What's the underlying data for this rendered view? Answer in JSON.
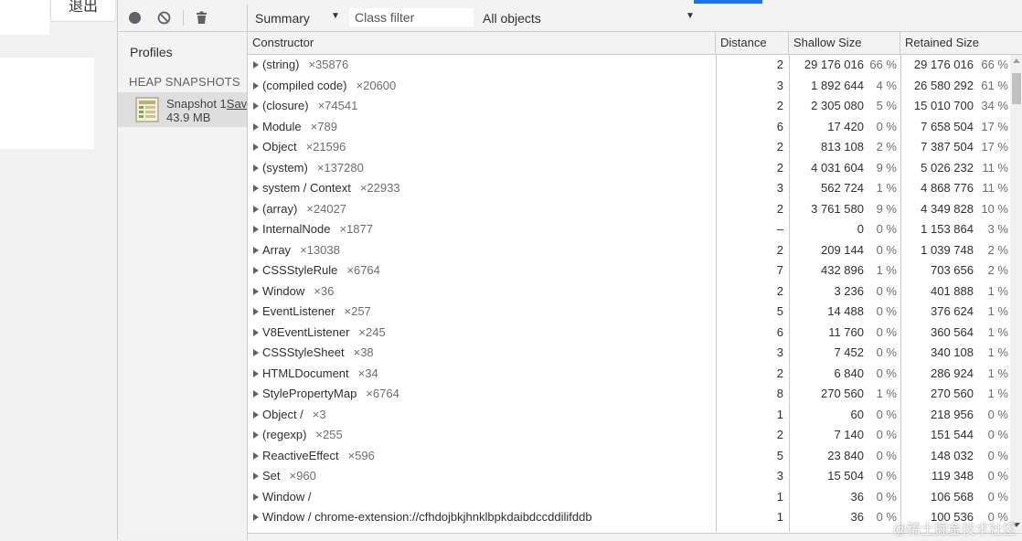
{
  "page": {
    "logout_label": "退出"
  },
  "sidebar": {
    "profiles_label": "Profiles",
    "heap_snapshots_label": "HEAP SNAPSHOTS",
    "snapshot": {
      "title": "Snapshot 1",
      "save_link": "Sav",
      "size": "43.9 MB"
    }
  },
  "toolbar": {
    "view": "Summary",
    "class_filter_placeholder": "Class filter",
    "objects": "All objects"
  },
  "columns": {
    "constructor": "Constructor",
    "distance": "Distance",
    "shallow": "Shallow Size",
    "retained": "Retained Size"
  },
  "rows": [
    {
      "name": "(string)",
      "count": "×35876",
      "distance": "2",
      "shallow": "29 176 016",
      "shallow_pct": "66 %",
      "retained": "29 176 016",
      "retained_pct": "66 %"
    },
    {
      "name": "(compiled code)",
      "count": "×20600",
      "distance": "3",
      "shallow": "1 892 644",
      "shallow_pct": "4 %",
      "retained": "26 580 292",
      "retained_pct": "61 %"
    },
    {
      "name": "(closure)",
      "count": "×74541",
      "distance": "2",
      "shallow": "2 305 080",
      "shallow_pct": "5 %",
      "retained": "15 010 700",
      "retained_pct": "34 %"
    },
    {
      "name": "Module",
      "count": "×789",
      "distance": "6",
      "shallow": "17 420",
      "shallow_pct": "0 %",
      "retained": "7 658 504",
      "retained_pct": "17 %"
    },
    {
      "name": "Object",
      "count": "×21596",
      "distance": "2",
      "shallow": "813 108",
      "shallow_pct": "2 %",
      "retained": "7 387 504",
      "retained_pct": "17 %"
    },
    {
      "name": "(system)",
      "count": "×137280",
      "distance": "2",
      "shallow": "4 031 604",
      "shallow_pct": "9 %",
      "retained": "5 026 232",
      "retained_pct": "11 %"
    },
    {
      "name": "system / Context",
      "count": "×22933",
      "distance": "3",
      "shallow": "562 724",
      "shallow_pct": "1 %",
      "retained": "4 868 776",
      "retained_pct": "11 %"
    },
    {
      "name": "(array)",
      "count": "×24027",
      "distance": "2",
      "shallow": "3 761 580",
      "shallow_pct": "9 %",
      "retained": "4 349 828",
      "retained_pct": "10 %"
    },
    {
      "name": "InternalNode",
      "count": "×1877",
      "distance": "–",
      "shallow": "0",
      "shallow_pct": "0 %",
      "retained": "1 153 864",
      "retained_pct": "3 %"
    },
    {
      "name": "Array",
      "count": "×13038",
      "distance": "2",
      "shallow": "209 144",
      "shallow_pct": "0 %",
      "retained": "1 039 748",
      "retained_pct": "2 %"
    },
    {
      "name": "CSSStyleRule",
      "count": "×6764",
      "distance": "7",
      "shallow": "432 896",
      "shallow_pct": "1 %",
      "retained": "703 656",
      "retained_pct": "2 %"
    },
    {
      "name": "Window",
      "count": "×36",
      "distance": "2",
      "shallow": "3 236",
      "shallow_pct": "0 %",
      "retained": "401 888",
      "retained_pct": "1 %"
    },
    {
      "name": "EventListener",
      "count": "×257",
      "distance": "5",
      "shallow": "14 488",
      "shallow_pct": "0 %",
      "retained": "376 624",
      "retained_pct": "1 %"
    },
    {
      "name": "V8EventListener",
      "count": "×245",
      "distance": "6",
      "shallow": "11 760",
      "shallow_pct": "0 %",
      "retained": "360 564",
      "retained_pct": "1 %"
    },
    {
      "name": "CSSStyleSheet",
      "count": "×38",
      "distance": "3",
      "shallow": "7 452",
      "shallow_pct": "0 %",
      "retained": "340 108",
      "retained_pct": "1 %"
    },
    {
      "name": "HTMLDocument",
      "count": "×34",
      "distance": "2",
      "shallow": "6 840",
      "shallow_pct": "0 %",
      "retained": "286 924",
      "retained_pct": "1 %"
    },
    {
      "name": "StylePropertyMap",
      "count": "×6764",
      "distance": "8",
      "shallow": "270 560",
      "shallow_pct": "1 %",
      "retained": "270 560",
      "retained_pct": "1 %"
    },
    {
      "name": "Object /",
      "count": "×3",
      "distance": "1",
      "shallow": "60",
      "shallow_pct": "0 %",
      "retained": "218 956",
      "retained_pct": "0 %"
    },
    {
      "name": "(regexp)",
      "count": "×255",
      "distance": "2",
      "shallow": "7 140",
      "shallow_pct": "0 %",
      "retained": "151 544",
      "retained_pct": "0 %"
    },
    {
      "name": "ReactiveEffect",
      "count": "×596",
      "distance": "5",
      "shallow": "23 840",
      "shallow_pct": "0 %",
      "retained": "148 032",
      "retained_pct": "0 %"
    },
    {
      "name": "Set",
      "count": "×960",
      "distance": "3",
      "shallow": "15 504",
      "shallow_pct": "0 %",
      "retained": "119 348",
      "retained_pct": "0 %"
    },
    {
      "name": "Window /",
      "count": "",
      "distance": "1",
      "shallow": "36",
      "shallow_pct": "0 %",
      "retained": "106 568",
      "retained_pct": "0 %"
    },
    {
      "name": "Window / chrome-extension://cfhdojbkjhnklbpkdaibdccddilifddb",
      "count": "",
      "distance": "1",
      "shallow": "36",
      "shallow_pct": "0 %",
      "retained": "100 536",
      "retained_pct": "0 %"
    }
  ],
  "watermark": "@稀土掘金技术社区",
  "colors": {
    "accent": "#1a73e8",
    "selection": "#dedede",
    "toolbar_bg": "#f3f3f3",
    "border": "#cbcdd1"
  }
}
